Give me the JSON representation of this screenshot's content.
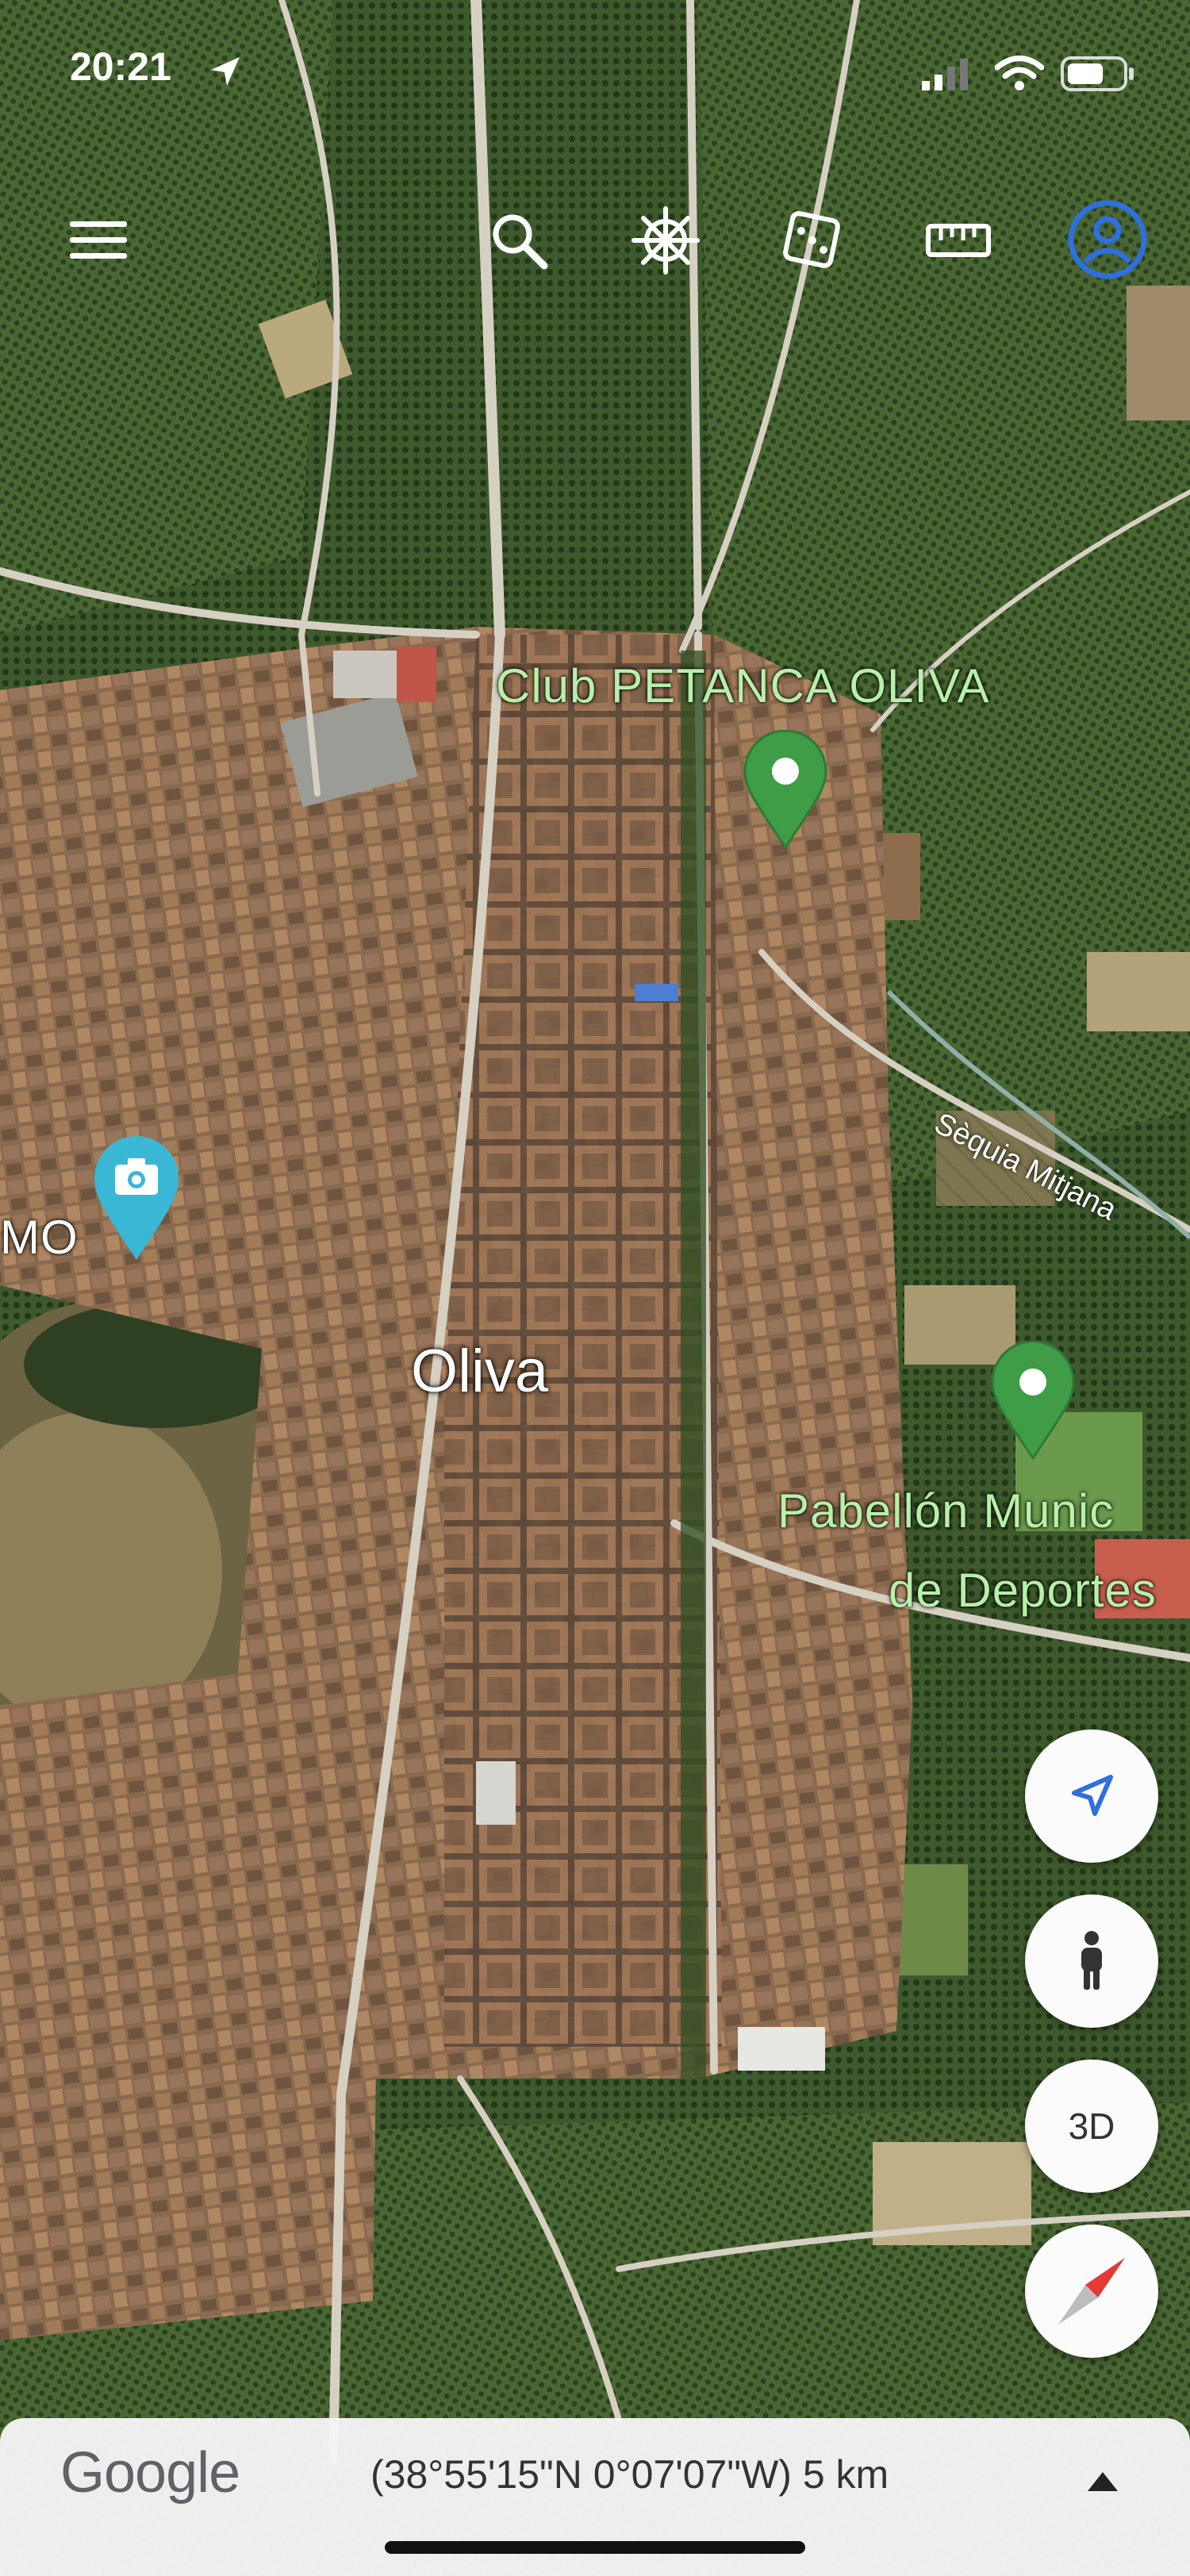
{
  "status_bar": {
    "time": "20:21",
    "icons": [
      "location-arrow-icon",
      "signal-icon",
      "wifi-icon",
      "battery-icon"
    ]
  },
  "toolbar": {
    "buttons": [
      "menu-icon",
      "search-icon",
      "voyager-wheel-icon",
      "dice-icon",
      "ruler-icon",
      "account-icon"
    ],
    "account_color": "#2f6fe0"
  },
  "map": {
    "place_labels": {
      "club": "Club PETANCA OLIVA",
      "pabellon_line1": "Pabellón Munic",
      "pabellon_line2": "de Deportes",
      "left_partial": "MO",
      "town": "Oliva",
      "canal": "Sèquia Mitjana"
    },
    "pin_color": "#3f9c47",
    "photo_pin_color": "#3bb7d6"
  },
  "controls": {
    "buttons": [
      "my-location-icon",
      "pegman-icon",
      "3d-button",
      "compass-icon"
    ],
    "three_d_label": "3D"
  },
  "bottom_bar": {
    "logo": "Google",
    "coordinates": "(38°55'15\"N 0°07'07\"W) 5 km"
  }
}
